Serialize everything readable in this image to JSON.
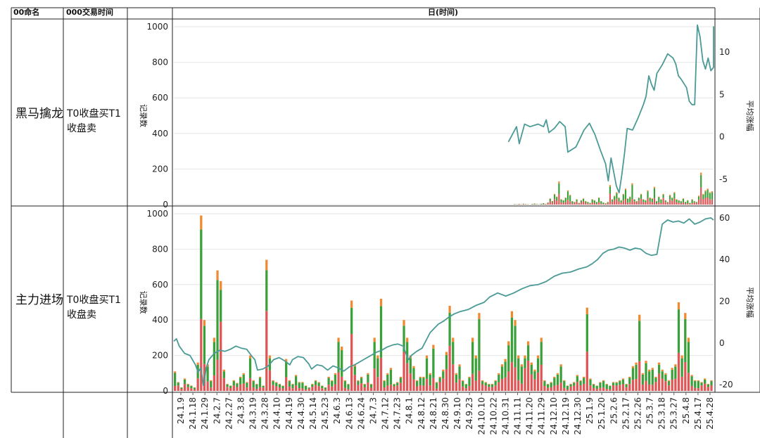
{
  "header": {
    "col_name": "00命名",
    "col_time": "000交易时间",
    "col_day": "日(时间)"
  },
  "rows": [
    {
      "name": "黑马擒龙",
      "time": "T0收盘买T1收盘卖"
    },
    {
      "name": "主力进场",
      "time": "T0收盘买T1收盘卖"
    }
  ],
  "colors": {
    "line": "#4a9a96",
    "bar_green": "#3aa03a",
    "bar_red": "#e05555",
    "bar_orange": "#f08a30",
    "grid": "#e6e6e6"
  },
  "chart_data": [
    {
      "type": "bar+line",
      "row": "黑马擒龙",
      "ylabel_left": "记录数",
      "ylabel_right": "平均涨幅",
      "ylim_left": [
        0,
        1000
      ],
      "yticks_left": [
        0,
        200,
        400,
        600,
        800,
        1000
      ],
      "ylim_right": [
        -8,
        13
      ],
      "yticks_right": [
        -5,
        0,
        5,
        10
      ],
      "bars_start": 0.63,
      "bars_end": 1.0,
      "bar_values": [
        3,
        2,
        4,
        2,
        5,
        3,
        2,
        0,
        4,
        6,
        3,
        2,
        5,
        8,
        4,
        12,
        35,
        20,
        60,
        45,
        130,
        30,
        25,
        40,
        80,
        55,
        20,
        15,
        30,
        10,
        25,
        35,
        20,
        15,
        10,
        30,
        25,
        15,
        40,
        20,
        12,
        8,
        15,
        110,
        30,
        50,
        70,
        40,
        25,
        60,
        90,
        35,
        45,
        120,
        30,
        20,
        40,
        60,
        30,
        25,
        80,
        40,
        35,
        100,
        20,
        45,
        30,
        60,
        25,
        15,
        55,
        40,
        70,
        30,
        25,
        20,
        35,
        15,
        25,
        10,
        30,
        20,
        15,
        50,
        180,
        60,
        80,
        90,
        70,
        75
      ],
      "line": [
        [
          0.62,
          -0.6
        ],
        [
          0.635,
          1.2
        ],
        [
          0.64,
          -0.8
        ],
        [
          0.65,
          1.5
        ],
        [
          0.66,
          1.2
        ],
        [
          0.675,
          1.5
        ],
        [
          0.685,
          1.2
        ],
        [
          0.69,
          2.0
        ],
        [
          0.695,
          0.5
        ],
        [
          0.705,
          1.0
        ],
        [
          0.715,
          1.8
        ],
        [
          0.725,
          1.2
        ],
        [
          0.73,
          -1.8
        ],
        [
          0.745,
          -1.2
        ],
        [
          0.76,
          0.8
        ],
        [
          0.77,
          1.6
        ],
        [
          0.78,
          0.3
        ],
        [
          0.79,
          -1.5
        ],
        [
          0.8,
          -3.2
        ],
        [
          0.805,
          -5.2
        ],
        [
          0.81,
          -2.5
        ],
        [
          0.82,
          -5.8
        ],
        [
          0.825,
          -6.6
        ],
        [
          0.83,
          -4.5
        ],
        [
          0.835,
          -2.0
        ],
        [
          0.84,
          1.0
        ],
        [
          0.85,
          0.8
        ],
        [
          0.86,
          2.2
        ],
        [
          0.87,
          3.8
        ],
        [
          0.875,
          4.8
        ],
        [
          0.88,
          7.2
        ],
        [
          0.885,
          6.2
        ],
        [
          0.89,
          5.5
        ],
        [
          0.895,
          7.5
        ],
        [
          0.905,
          8.5
        ],
        [
          0.915,
          9.8
        ],
        [
          0.925,
          9.3
        ],
        [
          0.93,
          8.6
        ],
        [
          0.935,
          7.2
        ],
        [
          0.94,
          6.8
        ],
        [
          0.95,
          5.8
        ],
        [
          0.955,
          4.2
        ],
        [
          0.96,
          3.8
        ],
        [
          0.965,
          3.8
        ],
        [
          0.97,
          13.2
        ],
        [
          0.975,
          11.8
        ],
        [
          0.98,
          9.0
        ],
        [
          0.985,
          8.0
        ],
        [
          0.99,
          9.3
        ],
        [
          0.995,
          7.8
        ],
        [
          1.0,
          8.2
        ],
        [
          1.005,
          12.3
        ],
        [
          1.01,
          13.0
        ],
        [
          1.015,
          12.2
        ]
      ]
    },
    {
      "type": "bar+line",
      "row": "主力进场",
      "ylabel_left": "记录数",
      "ylabel_right": "平均涨幅",
      "ylim_left": [
        0,
        1000
      ],
      "yticks_left": [
        0,
        200,
        400,
        600,
        800,
        1000
      ],
      "ylim_right": [
        -23,
        62
      ],
      "yticks_right": [
        -20,
        0,
        20,
        40,
        60
      ],
      "bars_start": 0.0,
      "bars_end": 1.0,
      "bar_values": [
        110,
        50,
        20,
        70,
        40,
        30,
        20,
        160,
        990,
        400,
        150,
        60,
        300,
        680,
        620,
        120,
        40,
        30,
        60,
        45,
        80,
        100,
        50,
        200,
        60,
        40,
        80,
        30,
        740,
        200,
        60,
        50,
        40,
        30,
        180,
        60,
        40,
        90,
        50,
        50,
        30,
        20,
        40,
        60,
        50,
        30,
        20,
        80,
        60,
        100,
        300,
        250,
        60,
        40,
        510,
        150,
        60,
        80,
        40,
        100,
        40,
        300,
        200,
        520,
        60,
        100,
        130,
        40,
        50,
        80,
        400,
        300,
        200,
        140,
        60,
        80,
        80,
        200,
        100,
        260,
        50,
        80,
        120,
        220,
        480,
        300,
        100,
        150,
        60,
        40,
        80,
        300,
        200,
        440,
        60,
        50,
        40,
        40,
        60,
        100,
        150,
        180,
        280,
        450,
        400,
        200,
        150,
        200,
        280,
        160,
        120,
        200,
        300,
        60,
        40,
        50,
        80,
        100,
        150,
        60,
        30,
        40,
        50,
        90,
        60,
        80,
        470,
        70,
        40,
        30,
        50,
        60,
        40,
        30,
        50,
        50,
        60,
        70,
        40,
        80,
        140,
        160,
        430,
        100,
        170,
        120,
        130,
        80,
        160,
        120,
        100,
        60,
        130,
        150,
        500,
        200,
        440,
        300,
        90,
        60,
        60,
        50,
        70,
        40,
        60
      ],
      "line": [
        [
          0.0,
          0.8
        ],
        [
          0.005,
          2.0
        ],
        [
          0.01,
          -1.5
        ],
        [
          0.02,
          -5.0
        ],
        [
          0.03,
          -6.0
        ],
        [
          0.04,
          -10.5
        ],
        [
          0.045,
          -14.0
        ],
        [
          0.05,
          -12.0
        ],
        [
          0.055,
          -20.5
        ],
        [
          0.06,
          -12.0
        ],
        [
          0.065,
          -8.0
        ],
        [
          0.075,
          -5.0
        ],
        [
          0.085,
          -3.5
        ],
        [
          0.095,
          -4.0
        ],
        [
          0.105,
          -3.0
        ],
        [
          0.115,
          -1.5
        ],
        [
          0.125,
          -2.5
        ],
        [
          0.135,
          -3.0
        ],
        [
          0.145,
          -6.5
        ],
        [
          0.15,
          -8.0
        ],
        [
          0.155,
          -13.0
        ],
        [
          0.165,
          -12.5
        ],
        [
          0.175,
          -11.0
        ],
        [
          0.185,
          -8.0
        ],
        [
          0.195,
          -7.0
        ],
        [
          0.205,
          -8.5
        ],
        [
          0.215,
          -10.5
        ],
        [
          0.22,
          -8.0
        ],
        [
          0.23,
          -6.5
        ],
        [
          0.24,
          -7.0
        ],
        [
          0.25,
          -10.0
        ],
        [
          0.255,
          -12.5
        ],
        [
          0.265,
          -10.5
        ],
        [
          0.275,
          -11.0
        ],
        [
          0.285,
          -13.0
        ],
        [
          0.295,
          -11.0
        ],
        [
          0.305,
          -12.0
        ],
        [
          0.315,
          -13.5
        ],
        [
          0.325,
          -11.5
        ],
        [
          0.335,
          -10.5
        ],
        [
          0.345,
          -9.0
        ],
        [
          0.355,
          -7.5
        ],
        [
          0.365,
          -6.0
        ],
        [
          0.375,
          -4.5
        ],
        [
          0.385,
          -3.5
        ],
        [
          0.395,
          -2.0
        ],
        [
          0.405,
          -1.0
        ],
        [
          0.415,
          -0.5
        ],
        [
          0.425,
          -1.5
        ],
        [
          0.43,
          -5.0
        ],
        [
          0.435,
          -8.0
        ],
        [
          0.44,
          -6.0
        ],
        [
          0.45,
          -4.0
        ],
        [
          0.46,
          -2.5
        ],
        [
          0.475,
          5.0
        ],
        [
          0.49,
          9.0
        ],
        [
          0.5,
          10.5
        ],
        [
          0.51,
          12.5
        ],
        [
          0.52,
          14.0
        ],
        [
          0.53,
          15.0
        ],
        [
          0.545,
          16.0
        ],
        [
          0.56,
          18.0
        ],
        [
          0.575,
          19.5
        ],
        [
          0.585,
          22.0
        ],
        [
          0.6,
          24.0
        ],
        [
          0.615,
          22.5
        ],
        [
          0.63,
          24.0
        ],
        [
          0.645,
          26.0
        ],
        [
          0.66,
          27.5
        ],
        [
          0.675,
          28.0
        ],
        [
          0.69,
          29.5
        ],
        [
          0.705,
          32.0
        ],
        [
          0.72,
          33.5
        ],
        [
          0.735,
          34.0
        ],
        [
          0.75,
          35.5
        ],
        [
          0.765,
          36.5
        ],
        [
          0.775,
          38.0
        ],
        [
          0.785,
          40.0
        ],
        [
          0.795,
          43.0
        ],
        [
          0.805,
          44.5
        ],
        [
          0.815,
          45.0
        ],
        [
          0.825,
          46.0
        ],
        [
          0.835,
          45.5
        ],
        [
          0.845,
          44.5
        ],
        [
          0.855,
          45.5
        ],
        [
          0.865,
          45.0
        ],
        [
          0.875,
          43.0
        ],
        [
          0.885,
          42.0
        ],
        [
          0.895,
          42.5
        ],
        [
          0.905,
          57.0
        ],
        [
          0.915,
          59.0
        ],
        [
          0.925,
          58.0
        ],
        [
          0.935,
          58.5
        ],
        [
          0.945,
          57.5
        ],
        [
          0.955,
          59.5
        ],
        [
          0.965,
          57.0
        ],
        [
          0.975,
          58.0
        ],
        [
          0.985,
          59.5
        ],
        [
          0.995,
          60.0
        ],
        [
          1.0,
          59.0
        ]
      ]
    }
  ],
  "x_ticks": [
    "24.1.9",
    "24.1.18",
    "24.1.29",
    "24.2.7",
    "24.2.27",
    "24.3.8",
    "24.3.19",
    "24.3.28",
    "24.4.10",
    "24.4.19",
    "24.4.30",
    "24.5.14",
    "24.5.23",
    "24.6.3",
    "24.6.13",
    "24.6.24",
    "24.7.3",
    "24.7.12",
    "24.7.23",
    "24.8.1",
    "24.8.12",
    "24.8.21",
    "24.8.30",
    "24.9.10",
    "24.9.23",
    "24.10.10",
    "24.10.22",
    "24.10.31",
    "24.11.11",
    "24.11.20",
    "24.11.29",
    "24.12.10",
    "24.12.19",
    "24.12.30",
    "25.1.9",
    "25.1.20",
    "25.2.6",
    "25.2.17",
    "25.2.26",
    "25.3.7",
    "25.3.18",
    "25.3.27",
    "25.4.8",
    "25.4.17",
    "25.4.28"
  ]
}
